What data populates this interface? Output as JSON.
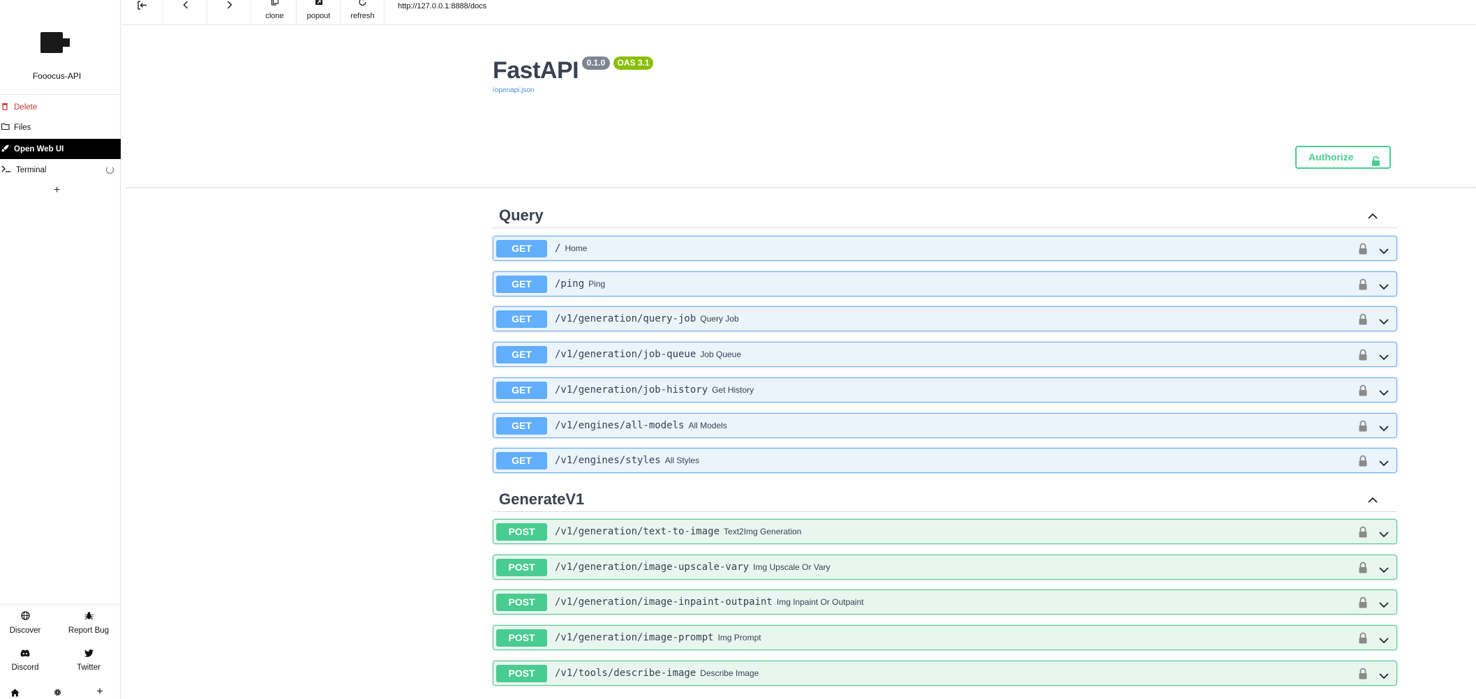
{
  "sidebar": {
    "app_name": "Fooocus-API",
    "items": [
      {
        "label": "Delete",
        "icon": "trash-icon"
      },
      {
        "label": "Files",
        "icon": "folder-icon"
      },
      {
        "label": "Open Web UI",
        "icon": "rocket-icon"
      },
      {
        "label": "Terminal",
        "icon": "terminal-icon"
      }
    ],
    "add_label": "+",
    "footer": [
      {
        "label": "Discover",
        "icon": "globe-icon"
      },
      {
        "label": "Report Bug",
        "icon": "bug-icon"
      },
      {
        "label": "Discord",
        "icon": "discord-icon"
      },
      {
        "label": "Twitter",
        "icon": "twitter-icon"
      }
    ],
    "bottom_bar": [
      "home-icon",
      "gear-icon",
      "plus-icon"
    ],
    "bottom_plus": "+"
  },
  "toolbar": {
    "clone_label": "clone",
    "popout_label": "popout",
    "refresh_label": "refresh",
    "url": "http://127.0.0.1:8888/docs"
  },
  "swagger": {
    "title": "FastAPI",
    "version": "0.1.0",
    "oas": "OAS 3.1",
    "openapi_link": "/openapi.json",
    "authorize_label": "Authorize"
  },
  "tags": [
    {
      "name": "Query",
      "operations": [
        {
          "method": "GET",
          "path": "/",
          "summary": "Home"
        },
        {
          "method": "GET",
          "path": "/ping",
          "summary": "Ping"
        },
        {
          "method": "GET",
          "path": "/v1/generation/query-job",
          "summary": "Query Job"
        },
        {
          "method": "GET",
          "path": "/v1/generation/job-queue",
          "summary": "Job Queue"
        },
        {
          "method": "GET",
          "path": "/v1/generation/job-history",
          "summary": "Get History"
        },
        {
          "method": "GET",
          "path": "/v1/engines/all-models",
          "summary": "All Models"
        },
        {
          "method": "GET",
          "path": "/v1/engines/styles",
          "summary": "All Styles"
        }
      ]
    },
    {
      "name": "GenerateV1",
      "operations": [
        {
          "method": "POST",
          "path": "/v1/generation/text-to-image",
          "summary": "Text2Img Generation"
        },
        {
          "method": "POST",
          "path": "/v1/generation/image-upscale-vary",
          "summary": "Img Upscale Or Vary"
        },
        {
          "method": "POST",
          "path": "/v1/generation/image-inpaint-outpaint",
          "summary": "Img Inpaint Or Outpaint"
        },
        {
          "method": "POST",
          "path": "/v1/generation/image-prompt",
          "summary": "Img Prompt"
        },
        {
          "method": "POST",
          "path": "/v1/tools/describe-image",
          "summary": "Describe Image"
        }
      ]
    }
  ],
  "colors": {
    "get": "#61affe",
    "post": "#49cc90",
    "delete_text": "#c0392b",
    "active_item_bg": "#000000"
  }
}
